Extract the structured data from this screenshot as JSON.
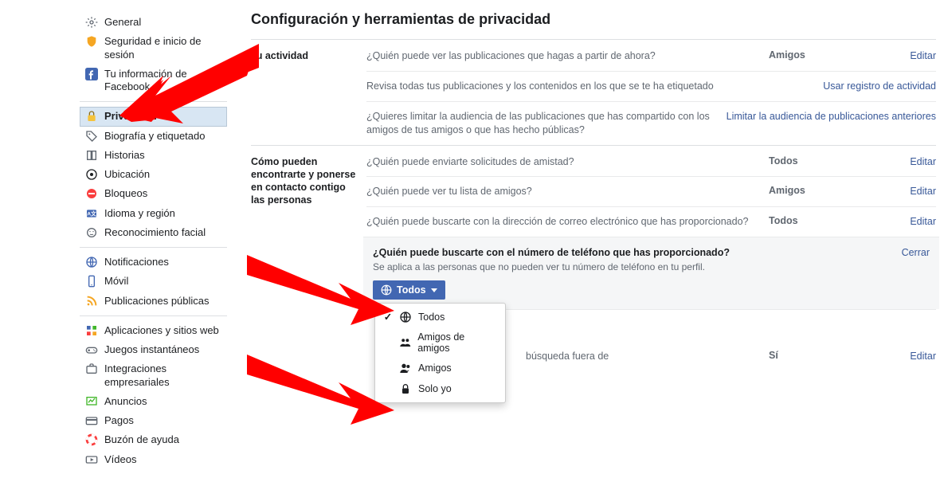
{
  "pageTitle": "Configuración y herramientas de privacidad",
  "sidebar": {
    "g1": [
      {
        "label": "General",
        "icon": "gear"
      },
      {
        "label": "Seguridad e inicio de sesión",
        "icon": "shield"
      },
      {
        "label": "Tu información de Facebook",
        "icon": "fb"
      }
    ],
    "g2": [
      {
        "label": "Privacidad",
        "icon": "lock",
        "active": true
      },
      {
        "label": "Biografía y etiquetado",
        "icon": "tag"
      },
      {
        "label": "Historias",
        "icon": "book"
      },
      {
        "label": "Ubicación",
        "icon": "loc"
      },
      {
        "label": "Bloqueos",
        "icon": "block"
      },
      {
        "label": "Idioma y región",
        "icon": "lang"
      },
      {
        "label": "Reconocimiento facial",
        "icon": "face"
      }
    ],
    "g3": [
      {
        "label": "Notificaciones",
        "icon": "globe"
      },
      {
        "label": "Móvil",
        "icon": "mobile"
      },
      {
        "label": "Publicaciones públicas",
        "icon": "rss"
      }
    ],
    "g4": [
      {
        "label": "Aplicaciones y sitios web",
        "icon": "apps"
      },
      {
        "label": "Juegos instantáneos",
        "icon": "games"
      },
      {
        "label": "Integraciones empresariales",
        "icon": "biz"
      },
      {
        "label": "Anuncios",
        "icon": "ads"
      },
      {
        "label": "Pagos",
        "icon": "card"
      },
      {
        "label": "Buzón de ayuda",
        "icon": "support"
      },
      {
        "label": "Vídeos",
        "icon": "video"
      }
    ]
  },
  "activity": {
    "sectionLabel": "Tu actividad",
    "r1q": "¿Quién puede ver las publicaciones que hagas a partir de ahora?",
    "r1v": "Amigos",
    "r1a": "Editar",
    "r2q": "Revisa todas tus publicaciones y los contenidos en los que se te ha etiquetado",
    "r2a": "Usar registro de actividad",
    "r3q": "¿Quieres limitar la audiencia de las publicaciones que has compartido con los amigos de tus amigos o que has hecho públicas?",
    "r3a": "Limitar la audiencia de publicaciones anteriores"
  },
  "contact": {
    "sectionLabel": "Cómo pueden encontrarte y ponerse en contacto contigo las personas",
    "r1q": "¿Quién puede enviarte solicitudes de amistad?",
    "r1v": "Todos",
    "r1a": "Editar",
    "r2q": "¿Quién puede ver tu lista de amigos?",
    "r2v": "Amigos",
    "r2a": "Editar",
    "r3q": "¿Quién puede buscarte con la dirección de correo electrónico que has proporcionado?",
    "r3v": "Todos",
    "r3a": "Editar",
    "expTitle": "¿Quién puede buscarte con el número de teléfono que has proporcionado?",
    "expSub": "Se aplica a las personas que no pueden ver tu número de teléfono en tu perfil.",
    "expClose": "Cerrar",
    "dropdownLabel": "Todos",
    "menu": [
      "Todos",
      "Amigos de amigos",
      "Amigos",
      "Solo yo"
    ],
    "r5q": "búsqueda fuera de",
    "r5v": "Sí",
    "r5a": "Editar"
  }
}
